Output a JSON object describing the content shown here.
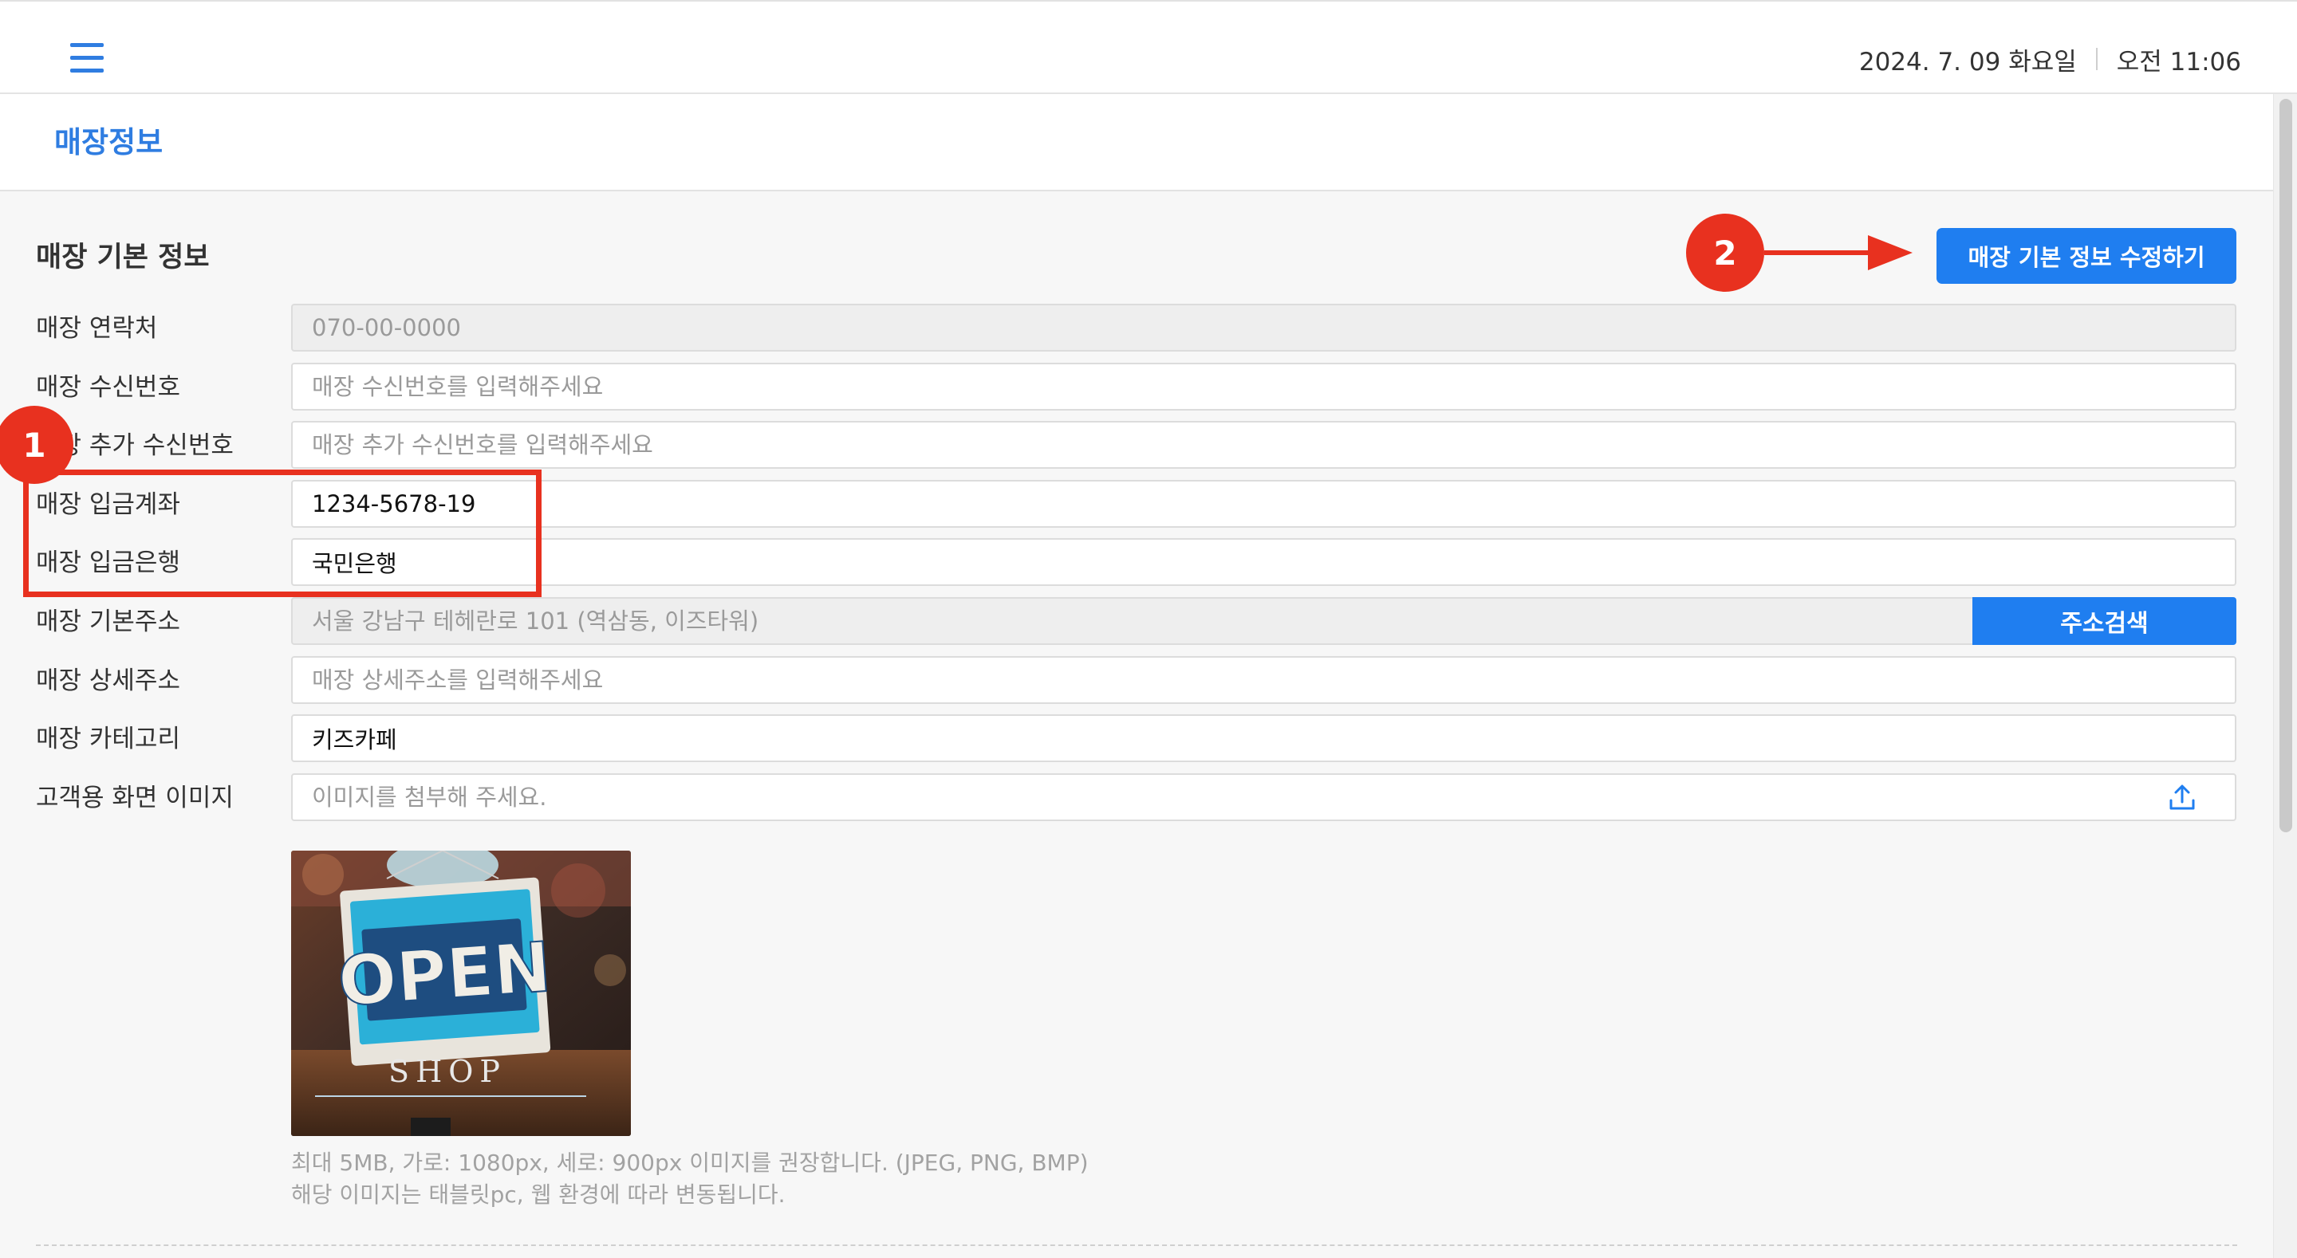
{
  "header": {
    "date": "2024. 7. 09 화요일",
    "time": "오전 11:06"
  },
  "page": {
    "title": "매장정보"
  },
  "section": {
    "title": "매장 기본 정보",
    "edit_button": "매장 기본 정보 수정하기"
  },
  "fields": {
    "contact": {
      "label": "매장 연락처",
      "placeholder": "070-00-0000",
      "value": ""
    },
    "receive_number": {
      "label": "매장 수신번호",
      "placeholder": "매장 수신번호를 입력해주세요",
      "value": ""
    },
    "extra_receive_number": {
      "label": "매장 추가 수신번호",
      "placeholder": "매장 추가 수신번호를 입력해주세요",
      "value": ""
    },
    "deposit_account": {
      "label": "매장 입금계좌",
      "placeholder": "",
      "value": "1234-5678-19"
    },
    "deposit_bank": {
      "label": "매장 입금은행",
      "placeholder": "",
      "value": "국민은행"
    },
    "base_address": {
      "label": "매장 기본주소",
      "placeholder": "서울 강남구 테헤란로 101 (역삼동, 이즈타워)",
      "value": "",
      "button": "주소검색"
    },
    "detail_address": {
      "label": "매장 상세주소",
      "placeholder": "매장 상세주소를 입력해주세요",
      "value": ""
    },
    "category": {
      "label": "매장 카테고리",
      "placeholder": "",
      "value": "키즈카페"
    },
    "customer_image": {
      "label": "고객용 화면 이미지",
      "placeholder": "이미지를 첨부해 주세요.",
      "value": ""
    }
  },
  "image_help": {
    "line1": "최대 5MB, 가로: 1080px, 세로: 900px 이미지를 권장합니다. (JPEG, PNG, BMP)",
    "line2": "해당 이미지는 태블릿pc, 웹 환경에 따라 변동됩니다."
  },
  "preview_image": {
    "sign_text": "OPEN",
    "sign_subtext": "SHOP"
  },
  "annotations": {
    "badge1": "1",
    "badge2": "2",
    "color": "#e8311f"
  },
  "colors": {
    "accent": "#1f7ef0",
    "title": "#2f7de1"
  },
  "icons": {
    "menu": "hamburger-menu-icon",
    "upload": "upload-icon"
  }
}
